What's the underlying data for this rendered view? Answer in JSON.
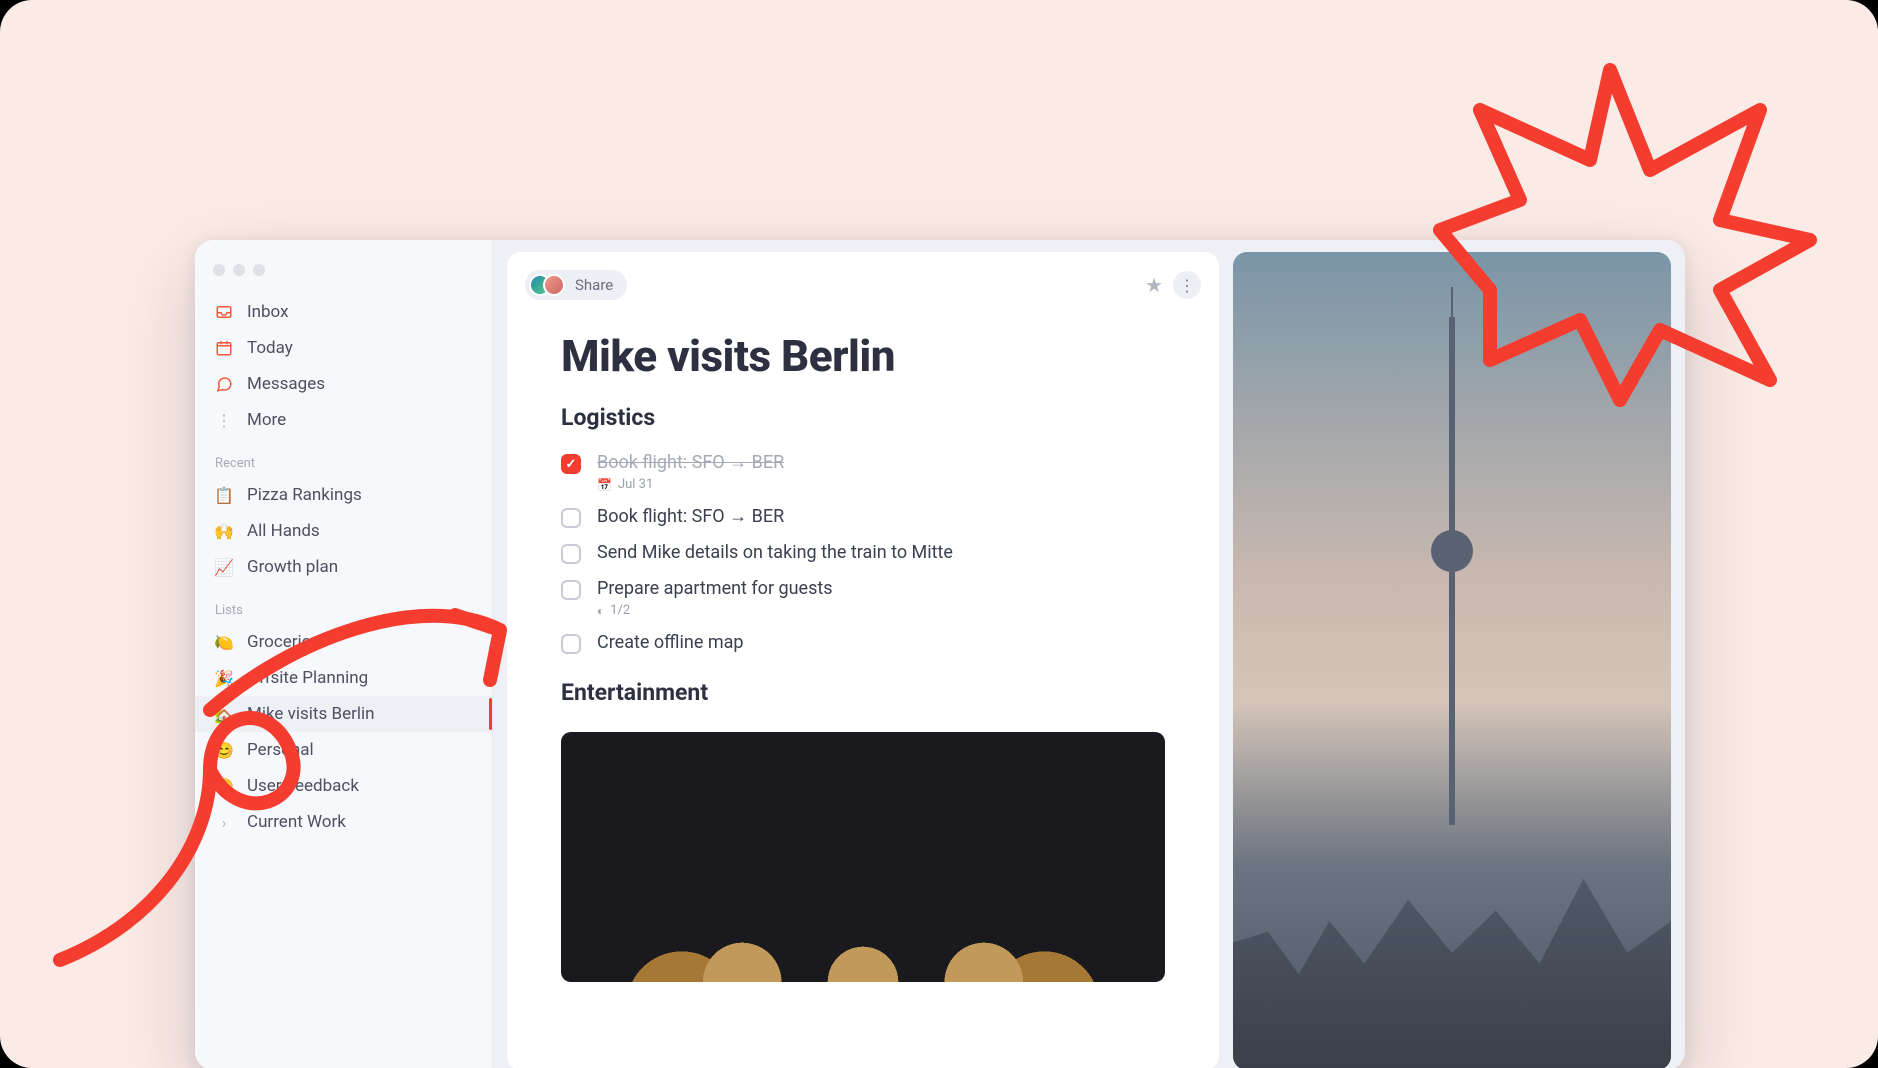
{
  "sidebar": {
    "nav": [
      {
        "icon": "inbox",
        "label": "Inbox"
      },
      {
        "icon": "calendar",
        "label": "Today"
      },
      {
        "icon": "chat",
        "label": "Messages"
      },
      {
        "icon": "more",
        "label": "More"
      }
    ],
    "recent_header": "Recent",
    "recent": [
      {
        "emoji": "📋",
        "label": "Pizza Rankings"
      },
      {
        "emoji": "🙌",
        "label": "All Hands"
      },
      {
        "emoji": "📈",
        "label": "Growth plan"
      }
    ],
    "lists_header": "Lists",
    "lists": [
      {
        "emoji": "🍋",
        "label": "Groceries"
      },
      {
        "emoji": "🎉",
        "label": "Offsite Planning"
      },
      {
        "emoji": "🏡",
        "label": "Mike visits Berlin",
        "active": true
      },
      {
        "emoji": "😊",
        "label": "Personal"
      },
      {
        "emoji": "😊",
        "label": "User Feedback"
      },
      {
        "emoji": "›",
        "label": "Current Work"
      }
    ]
  },
  "share_label": "Share",
  "doc": {
    "title": "Mike visits Berlin",
    "section1": "Logistics",
    "section2": "Entertainment",
    "tasks": [
      {
        "text": "Book flight: SFO → BER",
        "done": true,
        "date": "Jul 31"
      },
      {
        "text": "Book flight: SFO → BER",
        "done": false
      },
      {
        "text": "Send Mike details on taking the train to Mitte",
        "done": false
      },
      {
        "text": "Prepare apartment for guests",
        "done": false,
        "progress": "1/2"
      },
      {
        "text": "Create offline map",
        "done": false
      }
    ]
  }
}
